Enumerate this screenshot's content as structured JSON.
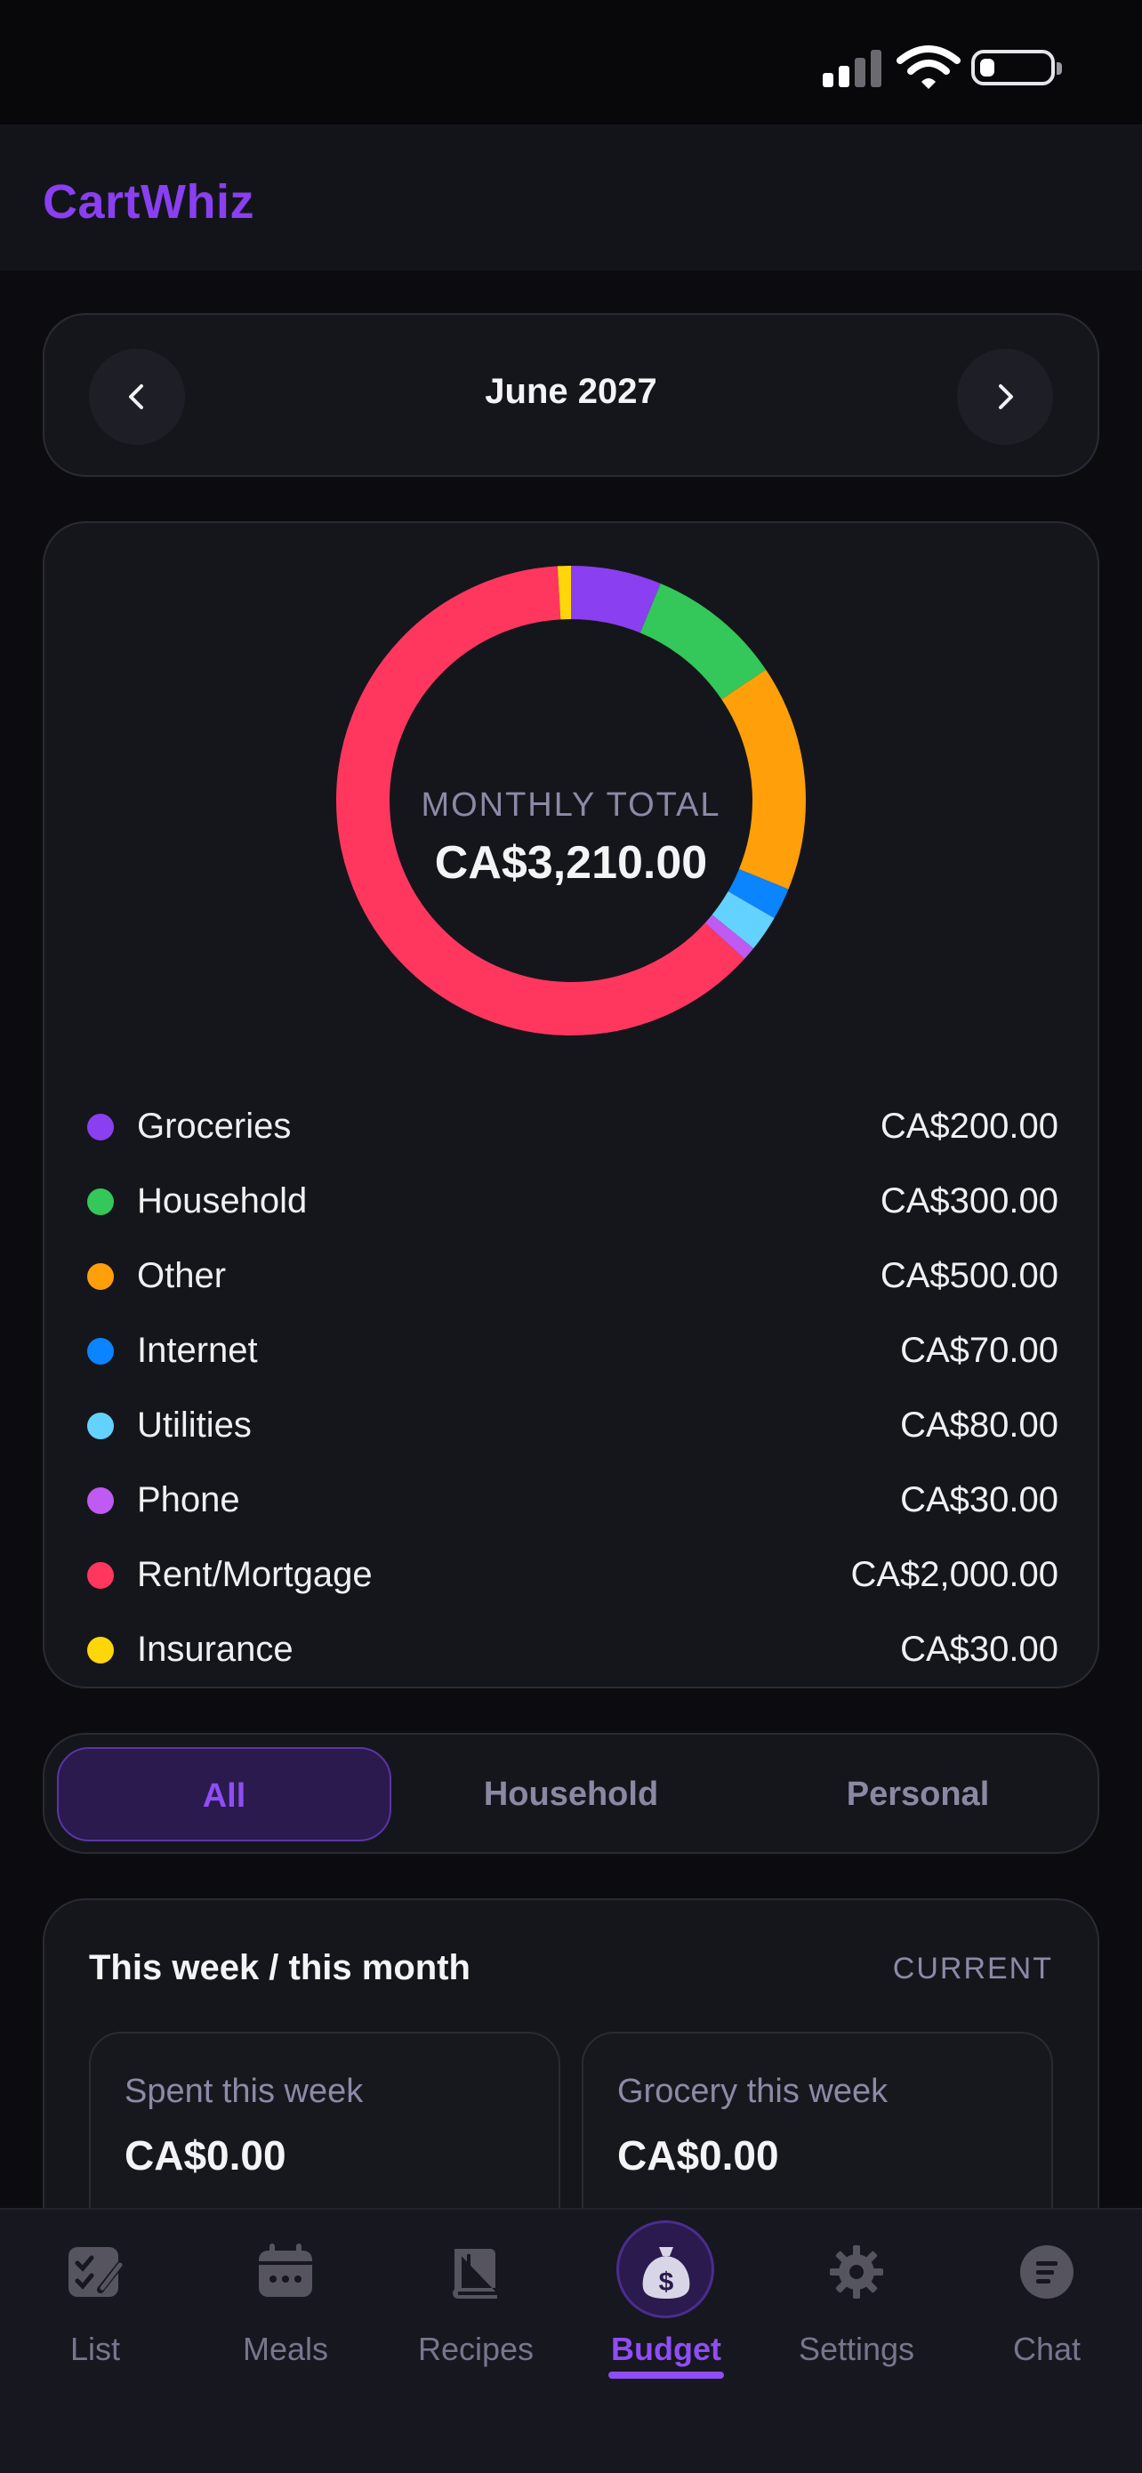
{
  "app": {
    "title": "CartWhiz"
  },
  "month_nav": {
    "label": "June 2027"
  },
  "summary": {
    "center_label": "MONTHLY TOTAL",
    "total": "CA$3,210.00"
  },
  "categories": [
    {
      "name": "Groceries",
      "value": "CA$200.00",
      "amount": 200,
      "color": "#8a3ff0"
    },
    {
      "name": "Household",
      "value": "CA$300.00",
      "amount": 300,
      "color": "#34c759"
    },
    {
      "name": "Other",
      "value": "CA$500.00",
      "amount": 500,
      "color": "#ff9f0a"
    },
    {
      "name": "Internet",
      "value": "CA$70.00",
      "amount": 70,
      "color": "#0a84ff"
    },
    {
      "name": "Utilities",
      "value": "CA$80.00",
      "amount": 80,
      "color": "#64d2ff"
    },
    {
      "name": "Phone",
      "value": "CA$30.00",
      "amount": 30,
      "color": "#bf5af2"
    },
    {
      "name": "Rent/Mortgage",
      "value": "CA$2,000.00",
      "amount": 2000,
      "color": "#ff375f"
    },
    {
      "name": "Insurance",
      "value": "CA$30.00",
      "amount": 30,
      "color": "#ffd60a"
    }
  ],
  "filter_tabs": [
    "All",
    "Household",
    "Personal"
  ],
  "week": {
    "title": "This week / this month",
    "badge": "CURRENT",
    "spent_label": "Spent this week",
    "spent_value": "CA$0.00",
    "grocery_label": "Grocery this week",
    "grocery_value": "CA$0.00"
  },
  "bottom_nav": [
    {
      "label": "List",
      "icon": "checklist-icon"
    },
    {
      "label": "Meals",
      "icon": "calendar-icon"
    },
    {
      "label": "Recipes",
      "icon": "book-icon"
    },
    {
      "label": "Budget",
      "icon": "money-bag-icon"
    },
    {
      "label": "Settings",
      "icon": "gear-icon"
    },
    {
      "label": "Chat",
      "icon": "chat-icon"
    }
  ]
}
